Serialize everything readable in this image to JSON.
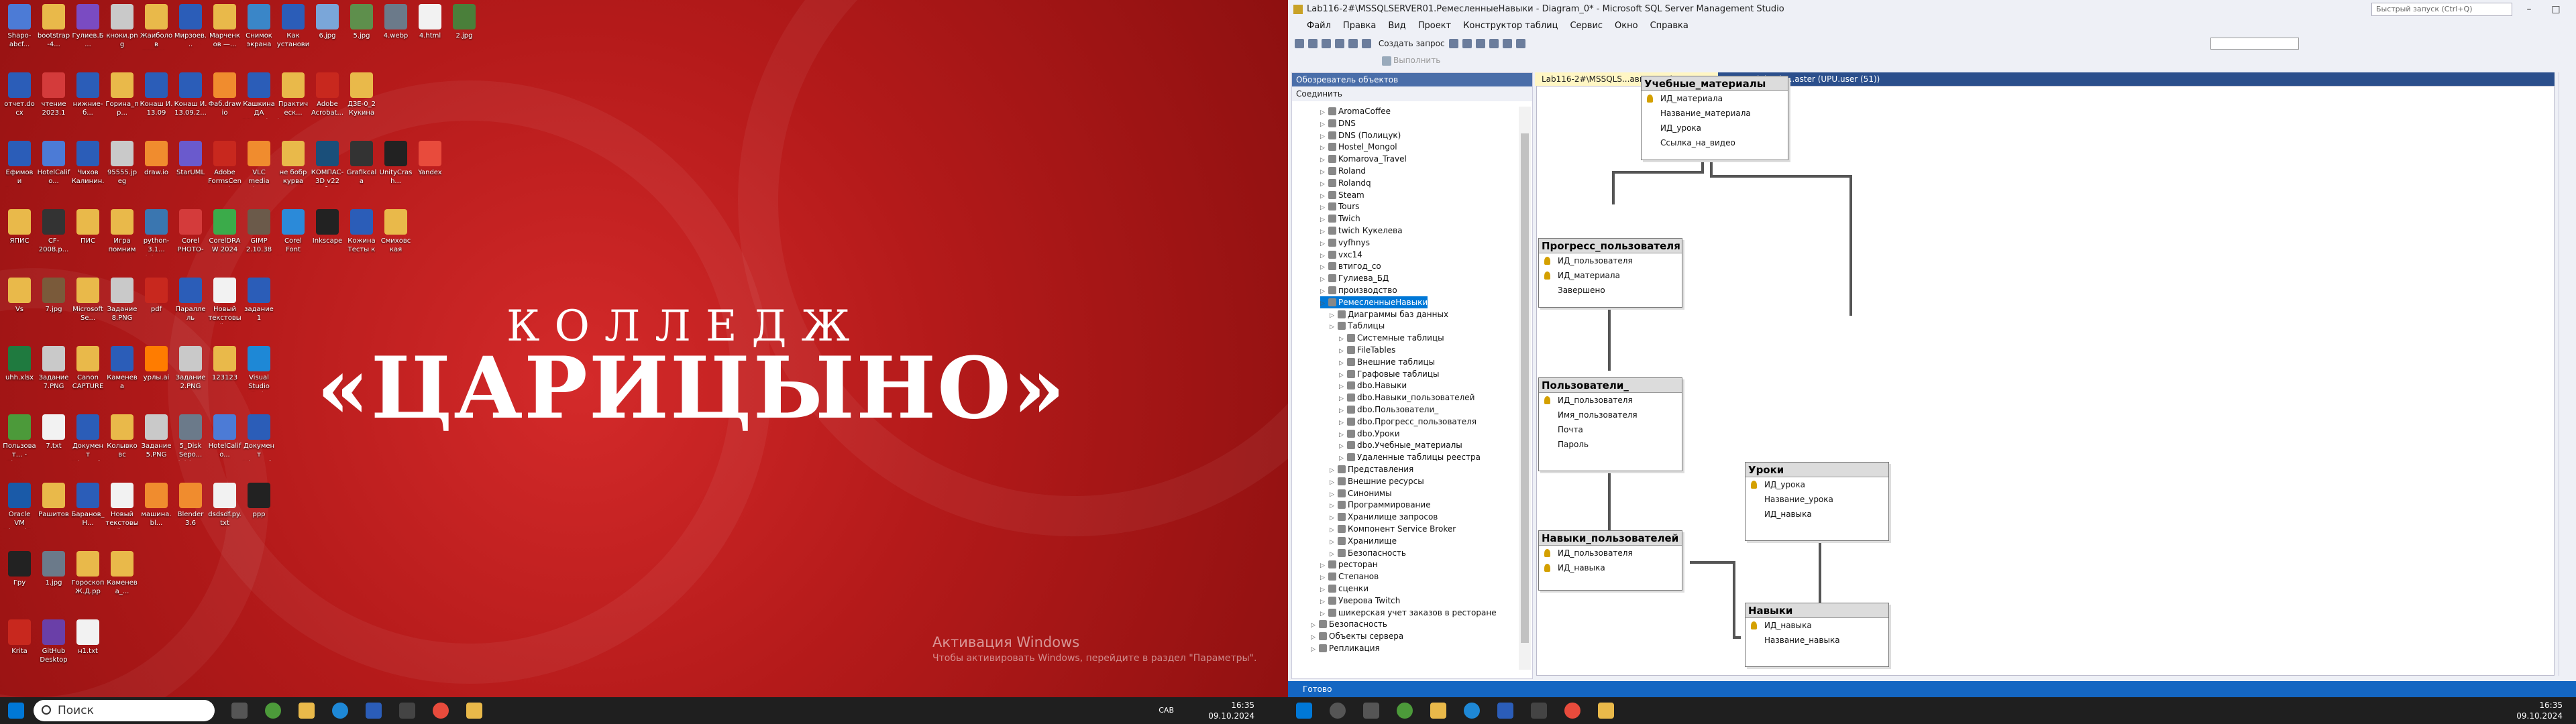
{
  "desktop": {
    "icons": [
      {
        "label": "Shapo-abcf...",
        "color": "#4c7bd6"
      },
      {
        "label": "bootstrap-4...",
        "color": "#e9b94a"
      },
      {
        "label": "Гулиев.Б...",
        "color": "#7a4bc2"
      },
      {
        "label": "кноки.png",
        "color": "#c9c9c9"
      },
      {
        "label": "Жаиболов ДРЕКИ...",
        "color": "#e9b94a"
      },
      {
        "label": "Мирзоев...",
        "color": "#2b5db8"
      },
      {
        "label": "Марченков —...",
        "color": "#e9b94a"
      },
      {
        "label": "Снимок экрана 2...",
        "color": "#3a86c8"
      },
      {
        "label": "Как установить видео уроки...",
        "color": "#2b5db8"
      },
      {
        "label": "6.jpg",
        "color": "#7aa6d9"
      },
      {
        "label": "5.jpg",
        "color": "#5e8f4c"
      },
      {
        "label": "4.webp",
        "color": "#6b7a8a"
      },
      {
        "label": "4.html",
        "color": "#f2f2f2"
      },
      {
        "label": "2.jpg",
        "color": "#4a7f3a"
      },
      {
        "label": "отчет.docx",
        "color": "#2b5db8"
      },
      {
        "label": "чтение 2023.1",
        "color": "#d43b3b"
      },
      {
        "label": "нижние-б...",
        "color": "#2b5db8"
      },
      {
        "label": "Горина_пр...",
        "color": "#e9b94a"
      },
      {
        "label": "Конаш И. 13.09 Конс...",
        "color": "#2b5db8"
      },
      {
        "label": "Конаш И. 13.09.2...",
        "color": "#2b5db8"
      },
      {
        "label": "Фаб.drawio",
        "color": "#f08c2e"
      },
      {
        "label": "Кашкина ДА 12.09.docx",
        "color": "#2b5db8"
      },
      {
        "label": "Практическ... (Шпорад...",
        "color": "#e9b94a"
      },
      {
        "label": "Adobe Acrobat...",
        "color": "#c8281e"
      },
      {
        "label": "ДЗЕ-0_2 Кукина",
        "color": "#e9b94a"
      },
      {
        "label": "Ефимов и Александр...",
        "color": "#2b5db8"
      },
      {
        "label": "HotelCalifo...",
        "color": "#4c7bd6"
      },
      {
        "label": "Чихов Калинин...",
        "color": "#2b5db8"
      },
      {
        "label": "95555.jpeg",
        "color": "#c9c9c9"
      },
      {
        "label": "draw.io",
        "color": "#f08c2e"
      },
      {
        "label": "StarUML",
        "color": "#6a5acd"
      },
      {
        "label": "Adobe FormsCentral",
        "color": "#c8281e"
      },
      {
        "label": "VLC media player",
        "color": "#f08c2e"
      },
      {
        "label": "не бобр курва",
        "color": "#e9b94a"
      },
      {
        "label": "КОМПАС-3D v22 Учебна...",
        "color": "#1a4f7a"
      },
      {
        "label": "Grafikcala",
        "color": "#333333"
      },
      {
        "label": "UnityCrash...",
        "color": "#222222"
      },
      {
        "label": "Yandex",
        "color": "#e84b3c"
      },
      {
        "label": "ЯПИС",
        "color": "#e9b94a"
      },
      {
        "label": "CF-2008.p...",
        "color": "#333333"
      },
      {
        "label": "ПИС",
        "color": "#e9b94a"
      },
      {
        "label": "Игра помним",
        "color": "#e9b94a"
      },
      {
        "label": "python-3.1... (1).exe",
        "color": "#3a76b0"
      },
      {
        "label": "Corel PHOTO-PAI...",
        "color": "#d43b3b"
      },
      {
        "label": "CorelDRAW 2024",
        "color": "#3bab4a"
      },
      {
        "label": "GIMP 2.10.38",
        "color": "#6b5a4a"
      },
      {
        "label": "Corel Font Manage...",
        "color": "#2b8ad9"
      },
      {
        "label": "Inkscape",
        "color": "#222222"
      },
      {
        "label": "Кожина Тесты к за...",
        "color": "#2b5db8"
      },
      {
        "label": "Смиховская приложен...",
        "color": "#e9b94a"
      },
      {
        "label": "Vs",
        "color": "#e9b94a"
      },
      {
        "label": "7.jpg",
        "color": "#7a5a3a"
      },
      {
        "label": "MicrosoftSe...",
        "color": "#e9b94a"
      },
      {
        "label": "Задание 8.PNG",
        "color": "#c9c9c9"
      },
      {
        "label": "pdf",
        "color": "#c8281e"
      },
      {
        "label": "Параллель вычислени...",
        "color": "#2b5db8"
      },
      {
        "label": "Новый текстовый...",
        "color": "#f2f2f2"
      },
      {
        "label": "задание 1 проводник...",
        "color": "#2b5db8"
      },
      {
        "label": "uhh.xlsx",
        "color": "#1f7a3f"
      },
      {
        "label": "Задание 7.PNG",
        "color": "#c9c9c9"
      },
      {
        "label": "Canon CAPTURE",
        "color": "#e9b94a"
      },
      {
        "label": "Каменева",
        "color": "#2b5db8"
      },
      {
        "label": "урлы.ai",
        "color": "#ff7c00"
      },
      {
        "label": "Задание 2.PNG",
        "color": "#c9c9c9"
      },
      {
        "label": "123123",
        "color": "#e9b94a"
      },
      {
        "label": "Visual Studio Code",
        "color": "#1e88d6"
      },
      {
        "label": "Пользоват... - Chrome",
        "color": "#4c9a3a"
      },
      {
        "label": "7.txt",
        "color": "#f2f2f2"
      },
      {
        "label": "Документ Microsoft...",
        "color": "#2b5db8"
      },
      {
        "label": "Колывковс",
        "color": "#e9b94a"
      },
      {
        "label": "Задание 5.PNG",
        "color": "#c9c9c9"
      },
      {
        "label": "5_Disk Sepo... (1).jpeg",
        "color": "#6b7a8a"
      },
      {
        "label": "HotelCalifo...",
        "color": "#4c7bd6"
      },
      {
        "label": "Документ Microsoft...",
        "color": "#2b5db8"
      },
      {
        "label": "Oracle VM VirtualBox",
        "color": "#1a5aa8"
      },
      {
        "label": "Рашитов",
        "color": "#e9b94a"
      },
      {
        "label": "Баранов_Н...",
        "color": "#2b5db8"
      },
      {
        "label": "Новый текстовый...",
        "color": "#f2f2f2"
      },
      {
        "label": "машина.bl...",
        "color": "#f08c2e"
      },
      {
        "label": "Blender 3.6",
        "color": "#f08c2e"
      },
      {
        "label": "dsdsdf.py.txt",
        "color": "#f2f2f2"
      },
      {
        "label": "ppp",
        "color": "#222222"
      },
      {
        "label": "Гру",
        "color": "#222222"
      },
      {
        "label": "1.jpg",
        "color": "#6b7a8a"
      },
      {
        "label": "Гороскоп Ж.Д.pp",
        "color": "#e9b94a"
      },
      {
        "label": "Каменева_...",
        "color": "#e9b94a"
      },
      {
        "label": "Krita",
        "color": "#c8281e"
      },
      {
        "label": "GitHub Desktop",
        "color": "#6a3fa8"
      },
      {
        "label": "н1.txt",
        "color": "#f2f2f2"
      }
    ],
    "logo_line1": "КОЛЛЕДЖ",
    "logo_line2": "«ЦАРИЦЫНО»",
    "activation_title": "Активация Windows",
    "activation_text": "Чтобы активировать Windows, перейдите в раздел \"Параметры\"."
  },
  "taskbar_left": {
    "search_placeholder": "Поиск",
    "clock_time": "16:35",
    "clock_date": "09.10.2024",
    "lang": "САВ"
  },
  "taskbar_right": {
    "clock_time": "16:35",
    "clock_date": "09.10.2024"
  },
  "ssms": {
    "title": "Lab116-2#\\MSSQLSERVER01.РемесленныеНавыки - Diagram_0* - Microsoft SQL Server Management Studio",
    "quick_search": "Быстрый запуск (Ctrl+Q)",
    "menu": [
      "Файл",
      "Правка",
      "Вид",
      "Проект",
      "Конструктор таблиц",
      "Сервис",
      "Окно",
      "Справка"
    ],
    "toolbar_new_query": "Создать запрос",
    "toolbar_execute": "Выполнить",
    "object_explorer": {
      "header": "Обозреватель объектов",
      "connect": "Соединить",
      "nodes": [
        {
          "label": "AromaCoffee",
          "level": 3
        },
        {
          "label": "DNS",
          "level": 3
        },
        {
          "label": "DNS (Полицук)",
          "level": 3
        },
        {
          "label": "Hostel_Mongol",
          "level": 3
        },
        {
          "label": "Komarova_Travel",
          "level": 3
        },
        {
          "label": "Roland",
          "level": 3
        },
        {
          "label": "Rolandq",
          "level": 3
        },
        {
          "label": "Steam",
          "level": 3
        },
        {
          "label": "Tours",
          "level": 3
        },
        {
          "label": "Twich",
          "level": 3
        },
        {
          "label": "twich Кукелева",
          "level": 3
        },
        {
          "label": "vyfhnys",
          "level": 3
        },
        {
          "label": "vxc14",
          "level": 3
        },
        {
          "label": "втигод_со",
          "level": 3
        },
        {
          "label": "Гулиева_БД",
          "level": 3
        },
        {
          "label": "производство",
          "level": 3
        },
        {
          "label": "РемесленныеНавыки",
          "level": 3,
          "selected": true
        },
        {
          "label": "Диаграммы баз данных",
          "level": 4
        },
        {
          "label": "Таблицы",
          "level": 4
        },
        {
          "label": "Системные таблицы",
          "level": 5
        },
        {
          "label": "FileTables",
          "level": 5
        },
        {
          "label": "Внешние таблицы",
          "level": 5
        },
        {
          "label": "Графовые таблицы",
          "level": 5
        },
        {
          "label": "dbo.Навыки",
          "level": 5
        },
        {
          "label": "dbo.Навыки_пользователей",
          "level": 5
        },
        {
          "label": "dbo.Пользователи_",
          "level": 5
        },
        {
          "label": "dbo.Прогресс_пользователя",
          "level": 5
        },
        {
          "label": "dbo.Уроки",
          "level": 5
        },
        {
          "label": "dbo.Учебные_материалы",
          "level": 5
        },
        {
          "label": "Удаленные таблицы реестра",
          "level": 5
        },
        {
          "label": "Представления",
          "level": 4
        },
        {
          "label": "Внешние ресурсы",
          "level": 4
        },
        {
          "label": "Синонимы",
          "level": 4
        },
        {
          "label": "Программирование",
          "level": 4
        },
        {
          "label": "Хранилище запросов",
          "level": 4
        },
        {
          "label": "Компонент Service Broker",
          "level": 4
        },
        {
          "label": "Хранилище",
          "level": 4
        },
        {
          "label": "Безопасность",
          "level": 4
        },
        {
          "label": "ресторан",
          "level": 3
        },
        {
          "label": "Степанов",
          "level": 3
        },
        {
          "label": "сценки",
          "level": 3
        },
        {
          "label": "Уверова Twitch",
          "level": 3
        },
        {
          "label": "шикерская учет заказов в ресторане",
          "level": 3
        },
        {
          "label": "Безопасность",
          "level": 2
        },
        {
          "label": "Объекты сервера",
          "level": 2
        },
        {
          "label": "Репликация",
          "level": 2
        }
      ]
    },
    "tabs": [
      {
        "label": "Lab116-2#\\MSSQLS...авыки - Diagram_0*",
        "active": true
      },
      {
        "label": "SQLQuery1 (3).sql -...aster (UPU.user (51))",
        "active": false
      }
    ],
    "diagram_tables": [
      {
        "name": "Учебные_материалы",
        "columns": [
          {
            "name": "ИД_материала",
            "pk": true
          },
          {
            "name": "Название_материала",
            "pk": false
          },
          {
            "name": "ИД_урока",
            "pk": false
          },
          {
            "name": "Ссылка_на_видео",
            "pk": false
          }
        ]
      },
      {
        "name": "Прогресс_пользователя",
        "columns": [
          {
            "name": "ИД_пользователя",
            "pk": true
          },
          {
            "name": "ИД_материала",
            "pk": true
          },
          {
            "name": "Завершено",
            "pk": false
          }
        ]
      },
      {
        "name": "Пользователи_",
        "columns": [
          {
            "name": "ИД_пользователя",
            "pk": true
          },
          {
            "name": "Имя_пользователя",
            "pk": false
          },
          {
            "name": "Почта",
            "pk": false
          },
          {
            "name": "Пароль",
            "pk": false
          }
        ]
      },
      {
        "name": "Навыки_пользователей",
        "columns": [
          {
            "name": "ИД_пользователя",
            "pk": true
          },
          {
            "name": "ИД_навыка",
            "pk": true
          }
        ]
      },
      {
        "name": "Уроки",
        "columns": [
          {
            "name": "ИД_урока",
            "pk": true
          },
          {
            "name": "Название_урока",
            "pk": false
          },
          {
            "name": "ИД_навыка",
            "pk": false
          }
        ]
      },
      {
        "name": "Навыки",
        "columns": [
          {
            "name": "ИД_навыка",
            "pk": true
          },
          {
            "name": "Название_навыка",
            "pk": false
          }
        ]
      }
    ],
    "status": "Готово"
  }
}
